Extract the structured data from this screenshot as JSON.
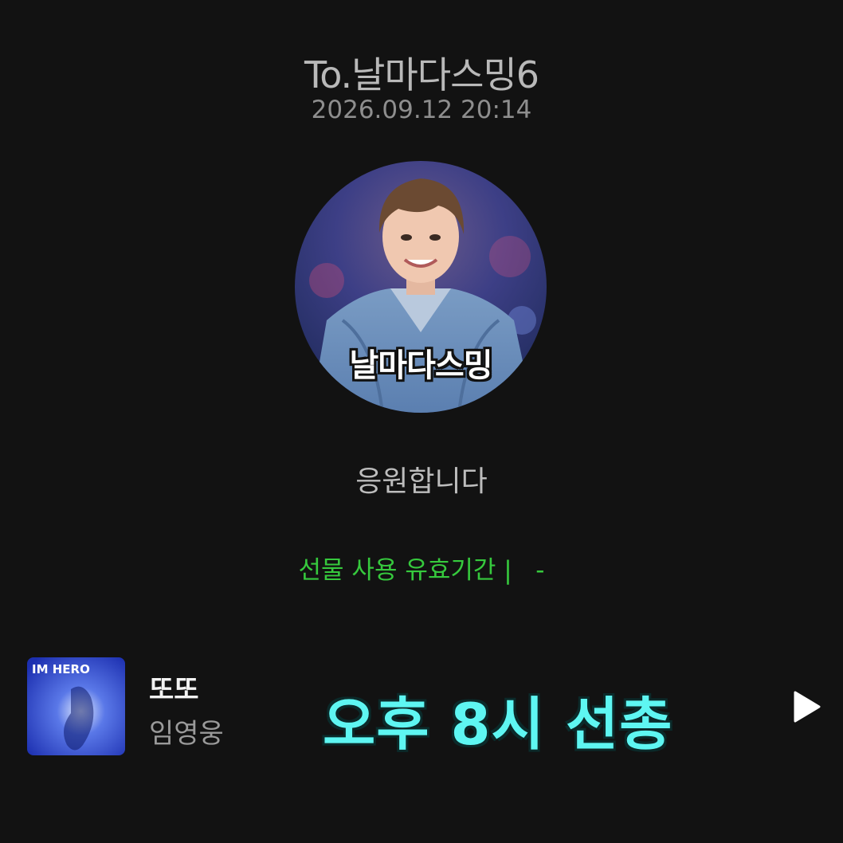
{
  "header": {
    "recipient": "To.날마다스밍6",
    "datetime": "2026.09.12 20:14"
  },
  "profile": {
    "caption": "날마다스밍"
  },
  "message": "응원합니다",
  "gift": {
    "validity": "선물 사용 유효기간 |   -"
  },
  "song": {
    "album_text": "IM HERO",
    "title": "또또",
    "artist": "임영웅"
  },
  "overlay": "오후 8시 선총",
  "colors": {
    "background": "#121212",
    "validity_green": "#36c93d",
    "overlay_cyan": "#5ef6f2"
  },
  "icons": {
    "play": "play-icon"
  }
}
